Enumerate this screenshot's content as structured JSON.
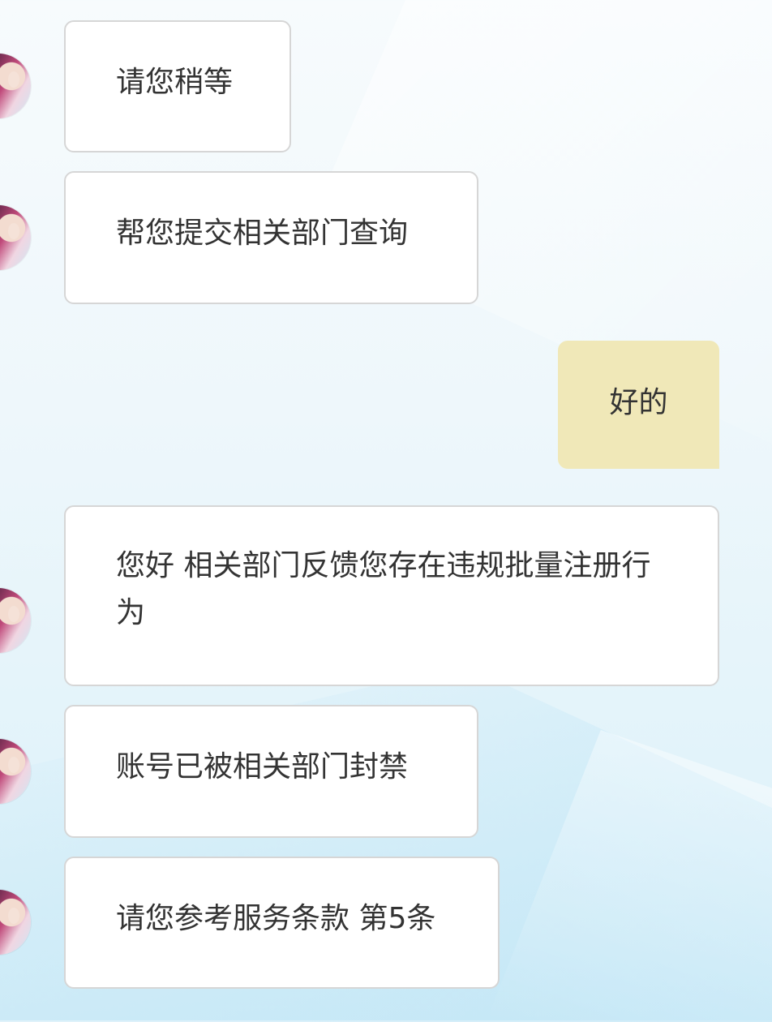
{
  "messages": [
    {
      "sender": "agent",
      "text": "请您稍等"
    },
    {
      "sender": "agent",
      "text": "帮您提交相关部门查询"
    },
    {
      "sender": "self",
      "text": "好的"
    },
    {
      "sender": "agent",
      "text": "您好 相关部门反馈您存在违规批量注册行为"
    },
    {
      "sender": "agent",
      "text": "账号已被相关部门封禁"
    },
    {
      "sender": "agent",
      "text": "请您参考服务条款 第5条"
    }
  ],
  "colors": {
    "agent_bubble": "#ffffff",
    "self_bubble": "#f0e8b8",
    "text": "#333333"
  }
}
